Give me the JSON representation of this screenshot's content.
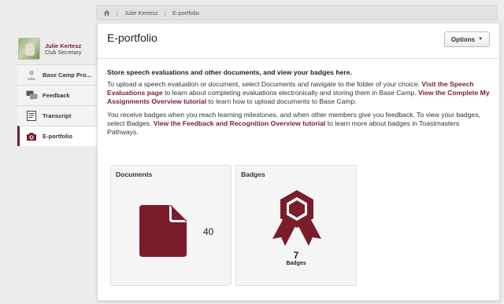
{
  "breadcrumb": {
    "home_icon": "home-icon",
    "items": [
      "Julie Kertesz",
      "E-portfolio"
    ]
  },
  "profile": {
    "name": "Julie Kertesz",
    "role": "Club Secretary"
  },
  "nav": {
    "items": [
      {
        "label": "Base Camp Pro...",
        "icon": "person-icon"
      },
      {
        "label": "Feedback",
        "icon": "chat-icon"
      },
      {
        "label": "Transcript",
        "icon": "transcript-icon"
      },
      {
        "label": "E-portfolio",
        "icon": "camera-icon",
        "active": true
      }
    ]
  },
  "panel": {
    "title": "E-portfolio",
    "options_label": "Options"
  },
  "content": {
    "lead": "Store speech evaluations and other documents, and view your badges here.",
    "p1_a": "To upload a speech evaluation or document, select Documents and navigate to the folder of your choice. ",
    "p1_link1": "Visit the Speech Evaluations page",
    "p1_b": " to learn about completing evaluations electronically and storing them in Base Camp. ",
    "p1_link2": "View the Complete My Assignments Overview tutorial",
    "p1_c": " to learn how to upload documents to Base Camp.",
    "p2_a": "You receive badges when you reach learning milestones, and when other members give you feedback. To view your badges, select Badges. ",
    "p2_link": "View the Feedback and Recognition Overview tutorial",
    "p2_b": " to learn more about badges in Toastmasters Pathways."
  },
  "cards": {
    "documents": {
      "title": "Documents",
      "count": "40"
    },
    "badges": {
      "title": "Badges",
      "count": "7",
      "label": "Badges"
    }
  },
  "colors": {
    "accent": "#7b1c2a",
    "background": "#ececec"
  }
}
